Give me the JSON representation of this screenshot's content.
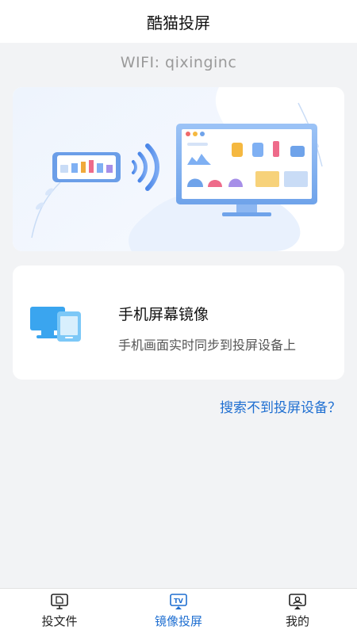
{
  "header": {
    "title": "酷猫投屏"
  },
  "wifi": {
    "label": "WIFI: qixinginc"
  },
  "mirror_card": {
    "title": "手机屏幕镜像",
    "subtitle": "手机画面实时同步到投屏设备上",
    "icon": "screen-mirror-icon"
  },
  "help_link": "搜索不到投屏设备？",
  "tabs": [
    {
      "label": "投文件",
      "icon": "cast-file-icon",
      "active": false
    },
    {
      "label": "镜像投屏",
      "icon": "tv-mirror-icon",
      "active": true
    },
    {
      "label": "我的",
      "icon": "profile-icon",
      "active": false
    }
  ],
  "colors": {
    "accent": "#1f6fd1",
    "background": "#f2f3f5"
  }
}
